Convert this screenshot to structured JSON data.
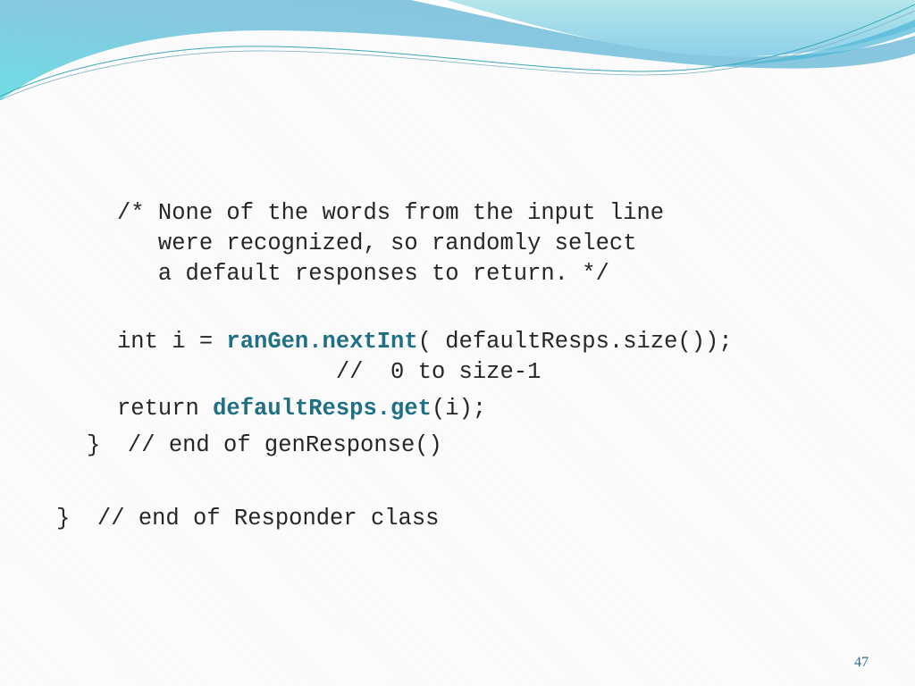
{
  "slide": {
    "page_number": "47",
    "accent_color": "#1f6f86",
    "comment": [
      "/* None of the words from the input line",
      "   were recognized, so randomly select",
      "   a default responses to return. */"
    ],
    "line_int": {
      "pre": "int i = ",
      "hl": "ranGen.nextInt",
      "post": "( defaultResps.size());"
    },
    "line_range_comment": "                //  0 to size-1",
    "line_return": {
      "pre": "return ",
      "hl": "defaultResps.get",
      "post": "(i);"
    },
    "line_end_method": "}  // end of genResponse()",
    "line_end_class": "}  // end of Responder class"
  }
}
